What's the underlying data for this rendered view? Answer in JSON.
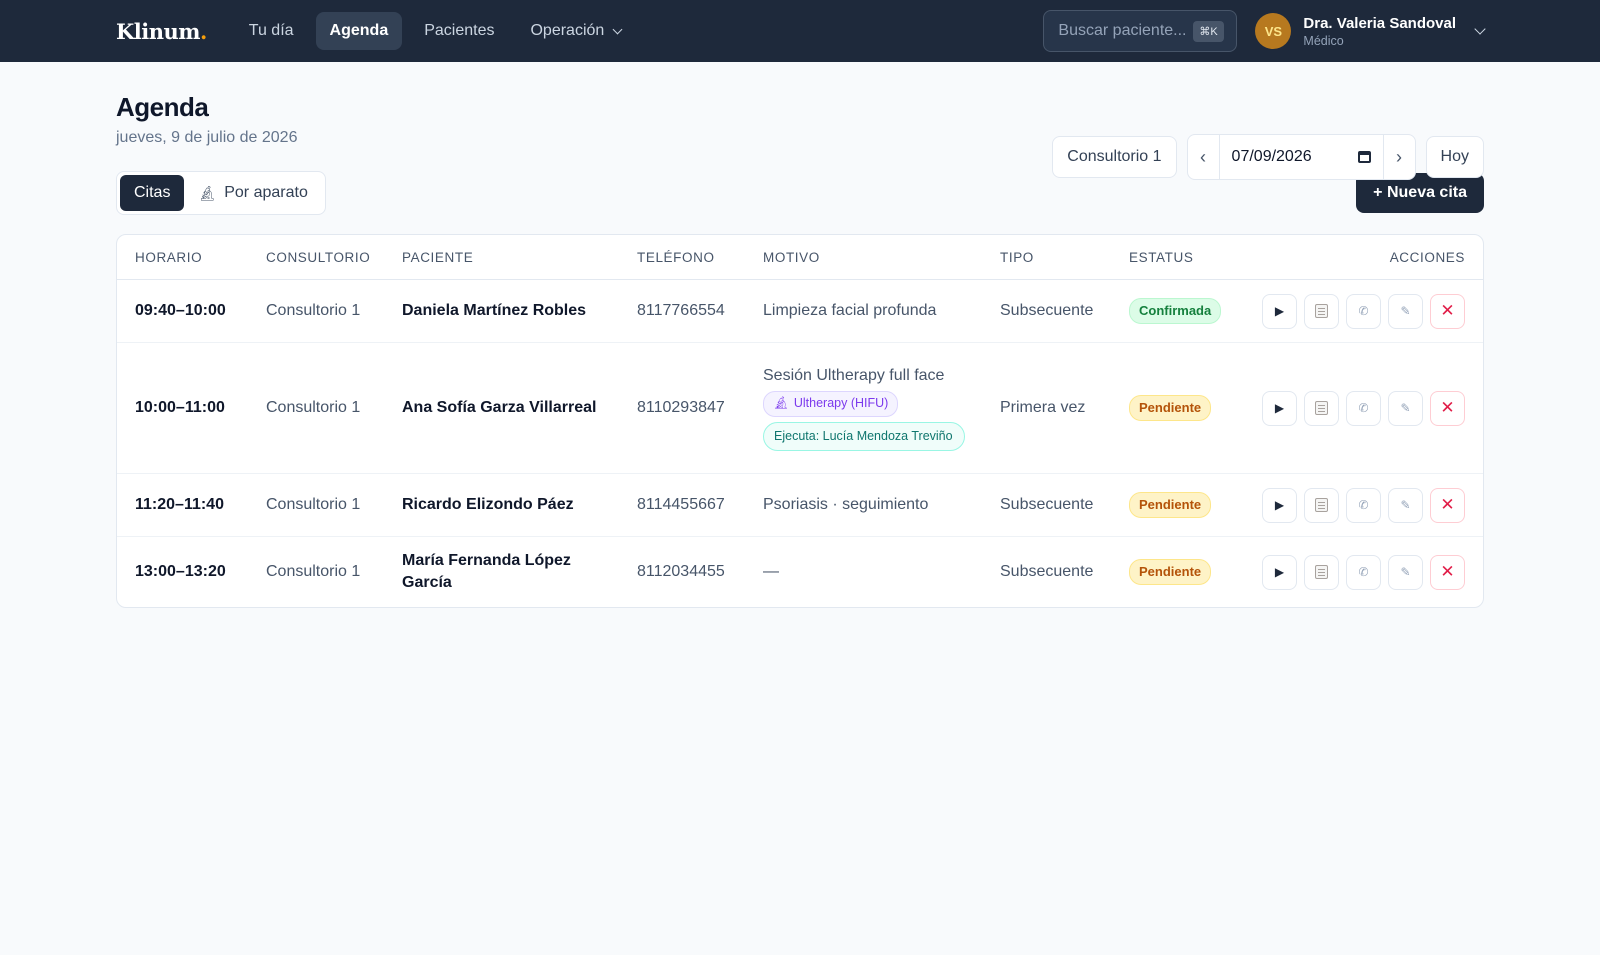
{
  "app": {
    "logo": "Klinum",
    "logo_dot": ".",
    "nav": [
      {
        "label": "Tu día"
      },
      {
        "label": "Agenda"
      },
      {
        "label": "Pacientes"
      },
      {
        "label": "Operación"
      }
    ],
    "search_placeholder": "Buscar paciente...",
    "search_shortcut": "⌘K",
    "user": {
      "initials": "VS",
      "name": "Dra. Valeria Sandoval",
      "role": "Médico"
    }
  },
  "page": {
    "title": "Agenda",
    "date_text": "jueves, 9 de julio de 2026",
    "room_select": "Consultorio 1",
    "prev": "‹",
    "next": "›",
    "date_value": "07/09/2026",
    "today_label": "Hoy",
    "view_tabs": [
      {
        "label": "Citas"
      },
      {
        "label": "Por aparato"
      }
    ],
    "new_button": "+ Nueva cita"
  },
  "table": {
    "columns": [
      "HORARIO",
      "CONSULTORIO",
      "PACIENTE",
      "TELÉFONO",
      "MOTIVO",
      "TIPO",
      "ESTATUS",
      "ACCIONES"
    ],
    "rows": [
      {
        "time": "09:40–10:00",
        "room": "Consultorio 1",
        "patient": "Daniela Martínez Robles",
        "phone": "8117766554",
        "reason": "Limpieza facial profunda",
        "type": "Subsecuente",
        "status": "Confirmada"
      },
      {
        "time": "10:00–11:00",
        "room": "Consultorio 1",
        "patient": "Ana Sofía Garza Villarreal",
        "phone": "8110293847",
        "reason": "Sesión Ultherapy full face",
        "device_tag": "Ultherapy (HIFU)",
        "executor": "Ejecuta: Lucía Mendoza Treviño",
        "type": "Primera vez",
        "status": "Pendiente"
      },
      {
        "time": "11:20–11:40",
        "room": "Consultorio 1",
        "patient": "Ricardo Elizondo Páez",
        "phone": "8114455667",
        "reason": "Psoriasis · seguimiento",
        "type": "Subsecuente",
        "status": "Pendiente"
      },
      {
        "time": "13:00–13:20",
        "room": "Consultorio 1",
        "patient": "María Fernanda López García",
        "phone": "8112034455",
        "reason": "—",
        "type": "Subsecuente",
        "status": "Pendiente"
      }
    ],
    "action_icons": {
      "start": "▶",
      "notes": "notes-icon",
      "attach": "✆",
      "edit": "✎",
      "cancel": "✕"
    }
  },
  "colors": {
    "nav_bg": "#1e293b",
    "confirmed": "#15803d",
    "pending": "#b45309",
    "device": "#7c3aed",
    "executor": "#0f766e",
    "danger": "#e11d48"
  }
}
